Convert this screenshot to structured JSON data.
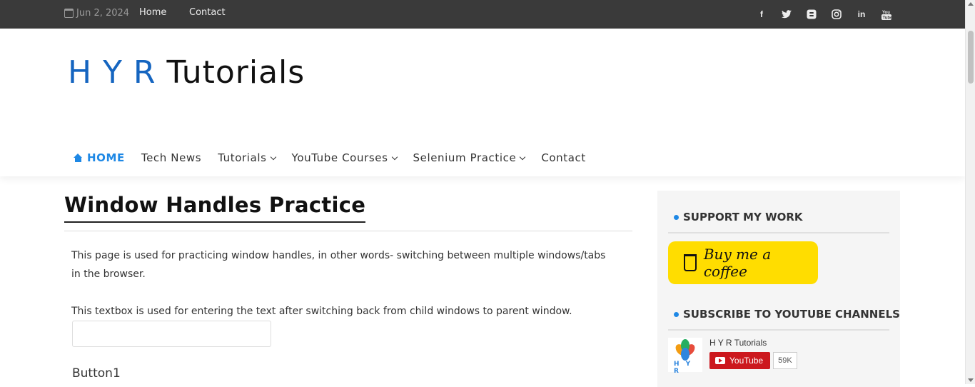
{
  "topbar": {
    "date": "Jun 2, 2024",
    "links": [
      "Home",
      "Contact"
    ],
    "social": [
      "facebook-icon",
      "twitter-icon",
      "blogger-icon",
      "instagram-icon",
      "linkedin-icon",
      "youtube-icon"
    ]
  },
  "logo": {
    "part1": "H Y R",
    "part2": "Tutorials"
  },
  "nav": {
    "home": "HOME",
    "items": [
      "Tech News",
      "Tutorials",
      "YouTube Courses",
      "Selenium Practice",
      "Contact"
    ]
  },
  "main": {
    "title": "Window Handles Practice",
    "para1": "This page is used for practicing window handles, in other words- switching between multiple windows/tabs in the browser.",
    "para2": "This textbox is used for entering the text after switching back from child windows to parent window.",
    "textbox_value": "",
    "button_label": "Button1"
  },
  "sidebar": {
    "support_title": "SUPPORT MY WORK",
    "coffee_label": "Buy me a coffee",
    "subscribe_title": "SUBSCRIBE TO YOUTUBE CHANNELS",
    "channel_name": "H Y R Tutorials",
    "thumb_text": "H Y R",
    "youtube_label": "YouTube",
    "subscriber_count": "59K"
  },
  "colors": {
    "accent": "#1e88e5",
    "topbar": "#3a3a3a",
    "coffee": "#ffdd00",
    "youtube": "#cc181e"
  }
}
